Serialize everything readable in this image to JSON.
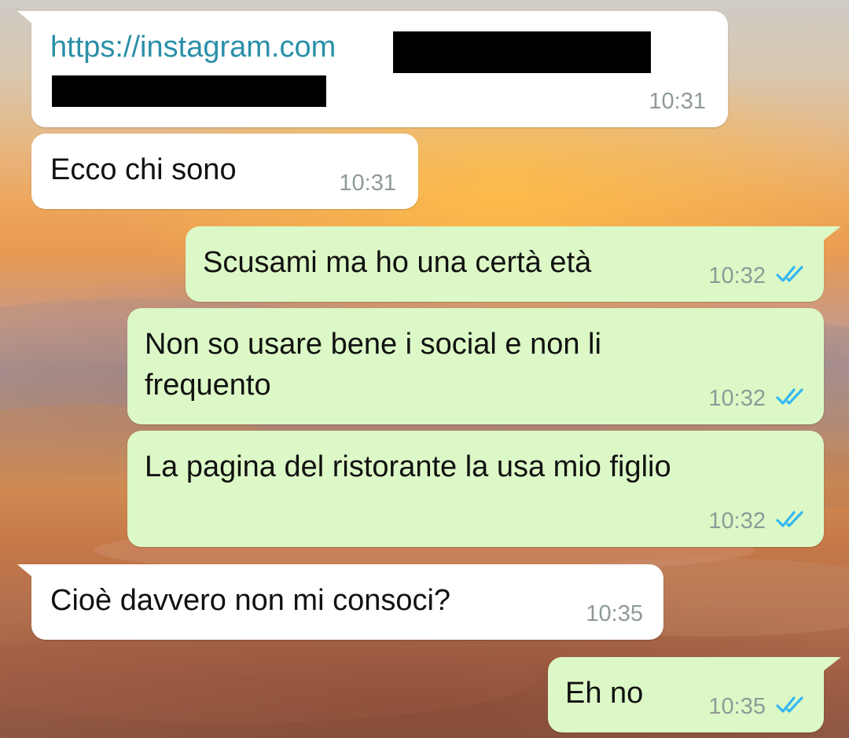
{
  "chat": {
    "messages": [
      {
        "direction": "incoming",
        "text": "https://instagram.com",
        "time": "10:31",
        "is_link": true,
        "redacted": true
      },
      {
        "direction": "incoming",
        "text": "Ecco chi sono",
        "time": "10:31"
      },
      {
        "direction": "outgoing",
        "text": "Scusami ma ho una certà età",
        "time": "10:32",
        "status": "read"
      },
      {
        "direction": "outgoing",
        "text_lines": [
          "Non so usare bene i social e non li",
          "frequento"
        ],
        "time": "10:32",
        "status": "read"
      },
      {
        "direction": "outgoing",
        "text": "La pagina del ristorante la usa mio figlio",
        "time": "10:32",
        "status": "read"
      },
      {
        "direction": "incoming",
        "text": "Cioè davvero non mi consoci?",
        "time": "10:35"
      },
      {
        "direction": "outgoing",
        "text": "Eh no",
        "time": "10:35",
        "status": "read"
      }
    ]
  },
  "colors": {
    "incoming_bubble": "#ffffff",
    "outgoing_bubble": "#dcf8c6",
    "link": "#2a8fa8",
    "read_ticks": "#34b7f1",
    "timestamp": "#8f9a98",
    "redaction": "#000000"
  },
  "icons": {
    "read_status": "double-check-icon"
  }
}
